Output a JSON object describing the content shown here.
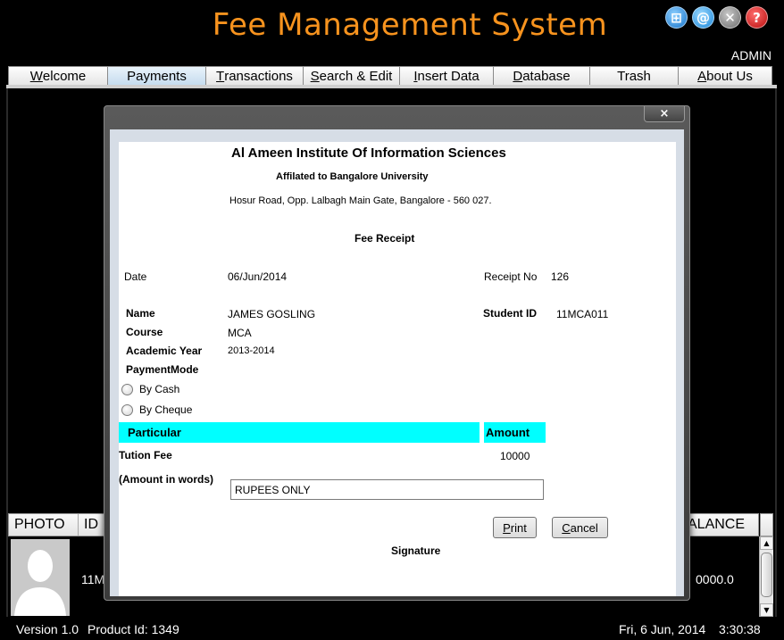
{
  "app": {
    "title": "Fee Management System",
    "user": "ADMIN"
  },
  "top_icons": [
    {
      "name": "grid-icon",
      "glyph": "⊞"
    },
    {
      "name": "email-at-icon",
      "glyph": "@"
    },
    {
      "name": "close-circle-icon",
      "glyph": "✕"
    },
    {
      "name": "help-icon",
      "glyph": "?"
    }
  ],
  "tabs": [
    {
      "label_ul": "W",
      "label_rest": "elcome"
    },
    {
      "label_ul": "",
      "label_rest": "Payments",
      "active": true
    },
    {
      "label_ul": "T",
      "label_rest": "ransactions"
    },
    {
      "label_ul": "S",
      "label_rest": "earch & Edit"
    },
    {
      "label_ul": "I",
      "label_rest": "nsert Data"
    },
    {
      "label_ul": "D",
      "label_rest": "atabase"
    },
    {
      "label_ul": "",
      "label_rest": "Trash"
    },
    {
      "label_ul": "A",
      "label_rest": "bout Us"
    }
  ],
  "table": {
    "headers": [
      "PHOTO",
      "ID",
      "ALANCE"
    ],
    "row": {
      "id": "11M",
      "balance": "0000.0"
    }
  },
  "status": {
    "version": "Version 1.0",
    "product": "Product Id: 1349",
    "date": "Fri, 6 Jun, 2014",
    "time": "3:30:38"
  },
  "dialog": {
    "close_label": "×",
    "institute": "Al Ameen Institute Of Information Sciences",
    "affiliation": "Affilated to Bangalore University",
    "address": "Hosur Road, Opp. Lalbagh Main Gate, Bangalore - 560 027.",
    "receipt_title": "Fee Receipt",
    "date_label": "Date",
    "date_value": "06/Jun/2014",
    "receipt_no_label": "Receipt No",
    "receipt_no_value": "126",
    "name_label": "Name",
    "name_value": "JAMES GOSLING",
    "student_id_label": "Student ID",
    "student_id_value": "11MCA011",
    "course_label": "Course",
    "course_value": "MCA",
    "academic_year_label": "Academic Year",
    "academic_year_value": "2013-2014",
    "payment_mode_label": "PaymentMode",
    "by_cash": "By Cash",
    "by_cheque": "By Cheque",
    "particular_header": "Particular",
    "amount_header": "Amount",
    "fee_label": "Tution Fee",
    "fee_amount": "10000",
    "words_label": "(Amount in words)",
    "words_value": "RUPEES ONLY",
    "print_ul": "P",
    "print_rest": "rint",
    "cancel_ul": "C",
    "cancel_rest": "ancel",
    "signature": "Signature"
  }
}
